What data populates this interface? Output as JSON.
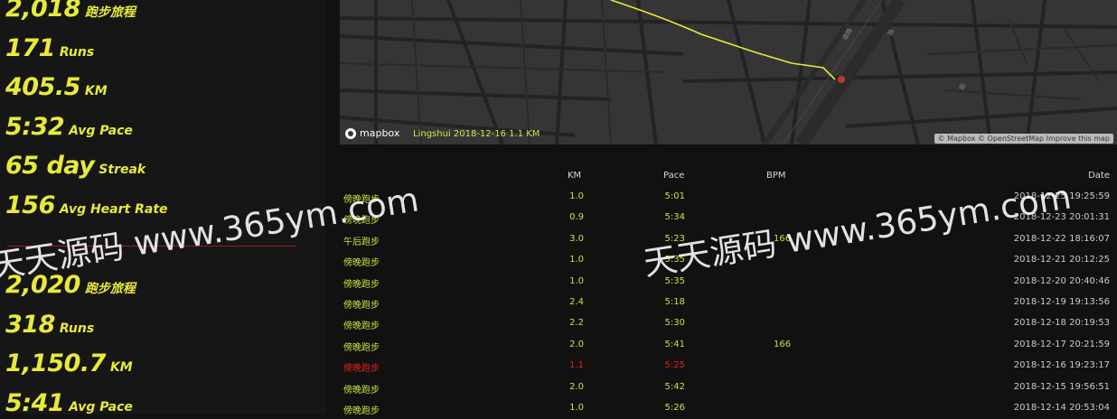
{
  "stats_current": [
    {
      "num": "2,018",
      "label": "跑步旅程"
    },
    {
      "num": "171",
      "label": "Runs"
    },
    {
      "num": "405.5",
      "label": "KM"
    },
    {
      "num": "5:32",
      "label": "Avg Pace"
    },
    {
      "num": "65 day",
      "label": "Streak"
    },
    {
      "num": "156",
      "label": "Avg Heart Rate"
    }
  ],
  "stats_previous": [
    {
      "num": "2,020",
      "label": "跑步旅程"
    },
    {
      "num": "318",
      "label": "Runs"
    },
    {
      "num": "1,150.7",
      "label": "KM"
    },
    {
      "num": "5:41",
      "label": "Avg Pace"
    }
  ],
  "map": {
    "logo": "mapbox",
    "caption": "Lingshui 2018-12-16 1.1 KM",
    "attribution": "© Mapbox © OpenStreetMap  Improve this map",
    "route_color": "#e8ea3a"
  },
  "table": {
    "headers": {
      "km": "KM",
      "pace": "Pace",
      "bpm": "BPM",
      "date": "Date"
    },
    "rows": [
      {
        "name": "傍晚跑步",
        "km": "1.0",
        "pace": "5:01",
        "bpm": "",
        "date": "2018-12-25 19:25:59"
      },
      {
        "name": "傍晚跑步",
        "km": "0.9",
        "pace": "5:34",
        "bpm": "",
        "date": "2018-12-23 20:01:31"
      },
      {
        "name": "午后跑步",
        "km": "3.0",
        "pace": "5:23",
        "bpm": "166",
        "date": "2018-12-22 18:16:07"
      },
      {
        "name": "傍晚跑步",
        "km": "1.0",
        "pace": "5:35",
        "bpm": "",
        "date": "2018-12-21 20:12:25"
      },
      {
        "name": "傍晚跑步",
        "km": "1.0",
        "pace": "5:35",
        "bpm": "",
        "date": "2018-12-20 20:40:46"
      },
      {
        "name": "傍晚跑步",
        "km": "2.4",
        "pace": "5:18",
        "bpm": "",
        "date": "2018-12-19 19:13:56"
      },
      {
        "name": "傍晚跑步",
        "km": "2.2",
        "pace": "5:30",
        "bpm": "",
        "date": "2018-12-18 20:19:53"
      },
      {
        "name": "傍晚跑步",
        "km": "2.0",
        "pace": "5:41",
        "bpm": "166",
        "date": "2018-12-17 20:21:59"
      },
      {
        "name": "傍晚跑步",
        "km": "1.1",
        "pace": "5:25",
        "bpm": "",
        "date": "2018-12-16 19:23:17"
      },
      {
        "name": "傍晚跑步",
        "km": "2.0",
        "pace": "5:42",
        "bpm": "",
        "date": "2018-12-15 19:56:51"
      },
      {
        "name": "傍晚跑步",
        "km": "1.0",
        "pace": "5:26",
        "bpm": "",
        "date": "2018-12-14 20:53:04"
      }
    ],
    "active_row_color": "#e0201e"
  },
  "watermark": "天天源码 www.365ym.com"
}
